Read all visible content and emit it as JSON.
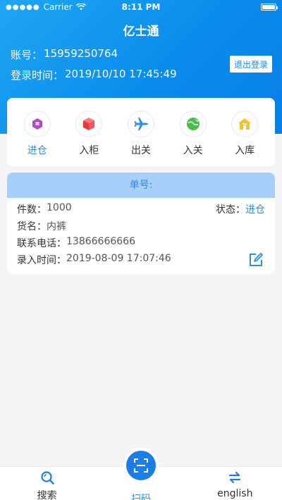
{
  "status_bar": {
    "carrier": "Carrier",
    "time": "8:11 PM"
  },
  "app": {
    "title": "亿士通"
  },
  "account": {
    "label": "账号：",
    "value": "15959250764",
    "login_time_label": "登录时间：",
    "login_time": "2019/10/10 17:45:49",
    "logout_label": "退出登录"
  },
  "menu": [
    {
      "label": "进仓",
      "icon": "warehouse-in-icon",
      "color": "#b24ac9",
      "active": true
    },
    {
      "label": "入柜",
      "icon": "box-icon",
      "color": "#f0464b",
      "active": false
    },
    {
      "label": "出关",
      "icon": "airplane-icon",
      "color": "#2f8fe4",
      "active": false
    },
    {
      "label": "入关",
      "icon": "globe-plane-icon",
      "color": "#4cbc4c",
      "active": false
    },
    {
      "label": "入库",
      "icon": "house-icon",
      "color": "#f4c22b",
      "active": false
    }
  ],
  "order": {
    "head": "单号:",
    "count_label": "件数：",
    "count": "1000",
    "status_label": "状态：",
    "status": "进仓",
    "goods_label": "货名：",
    "goods": "内裤",
    "phone_label": "联系电话：",
    "phone": "13866666666",
    "entry_label": "录入时间：",
    "entry_time": "2019-08-09 17:07:46"
  },
  "tabbar": {
    "search": "搜索",
    "scan": "扫码",
    "language": "english"
  }
}
